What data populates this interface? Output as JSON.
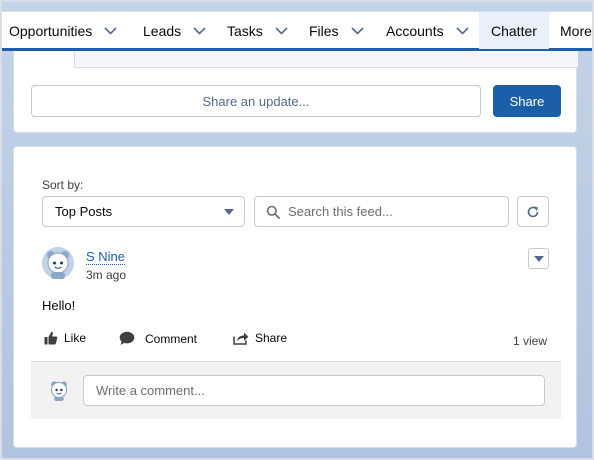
{
  "nav": {
    "items": [
      {
        "label": "Opportunities",
        "has_dropdown": true,
        "active": false
      },
      {
        "label": "Leads",
        "has_dropdown": true,
        "active": false
      },
      {
        "label": "Tasks",
        "has_dropdown": true,
        "active": false
      },
      {
        "label": "Files",
        "has_dropdown": true,
        "active": false
      },
      {
        "label": "Accounts",
        "has_dropdown": true,
        "active": false
      },
      {
        "label": "Chatter",
        "has_dropdown": false,
        "active": true
      },
      {
        "label": "More",
        "has_dropdown": false,
        "active": false
      }
    ]
  },
  "publisher": {
    "placeholder": "Share an update...",
    "share_label": "Share"
  },
  "feed": {
    "sort_label": "Sort by:",
    "sort_value": "Top Posts",
    "search_placeholder": "Search this feed...",
    "post": {
      "author": "S Nine",
      "time": "3m ago",
      "body": "Hello!",
      "actions": {
        "like": "Like",
        "comment": "Comment",
        "share": "Share"
      },
      "views": "1 view",
      "comment_placeholder": "Write a comment..."
    }
  },
  "colors": {
    "brand": "#1b5fa8",
    "background": "#b0c4df",
    "text": "#080707"
  },
  "icons": {
    "chevron": "chevron-down-icon",
    "search": "search-icon",
    "refresh": "refresh-icon",
    "like": "thumbs-up-icon",
    "comment": "comment-icon",
    "share": "share-icon",
    "avatar": "astro-avatar-icon"
  }
}
